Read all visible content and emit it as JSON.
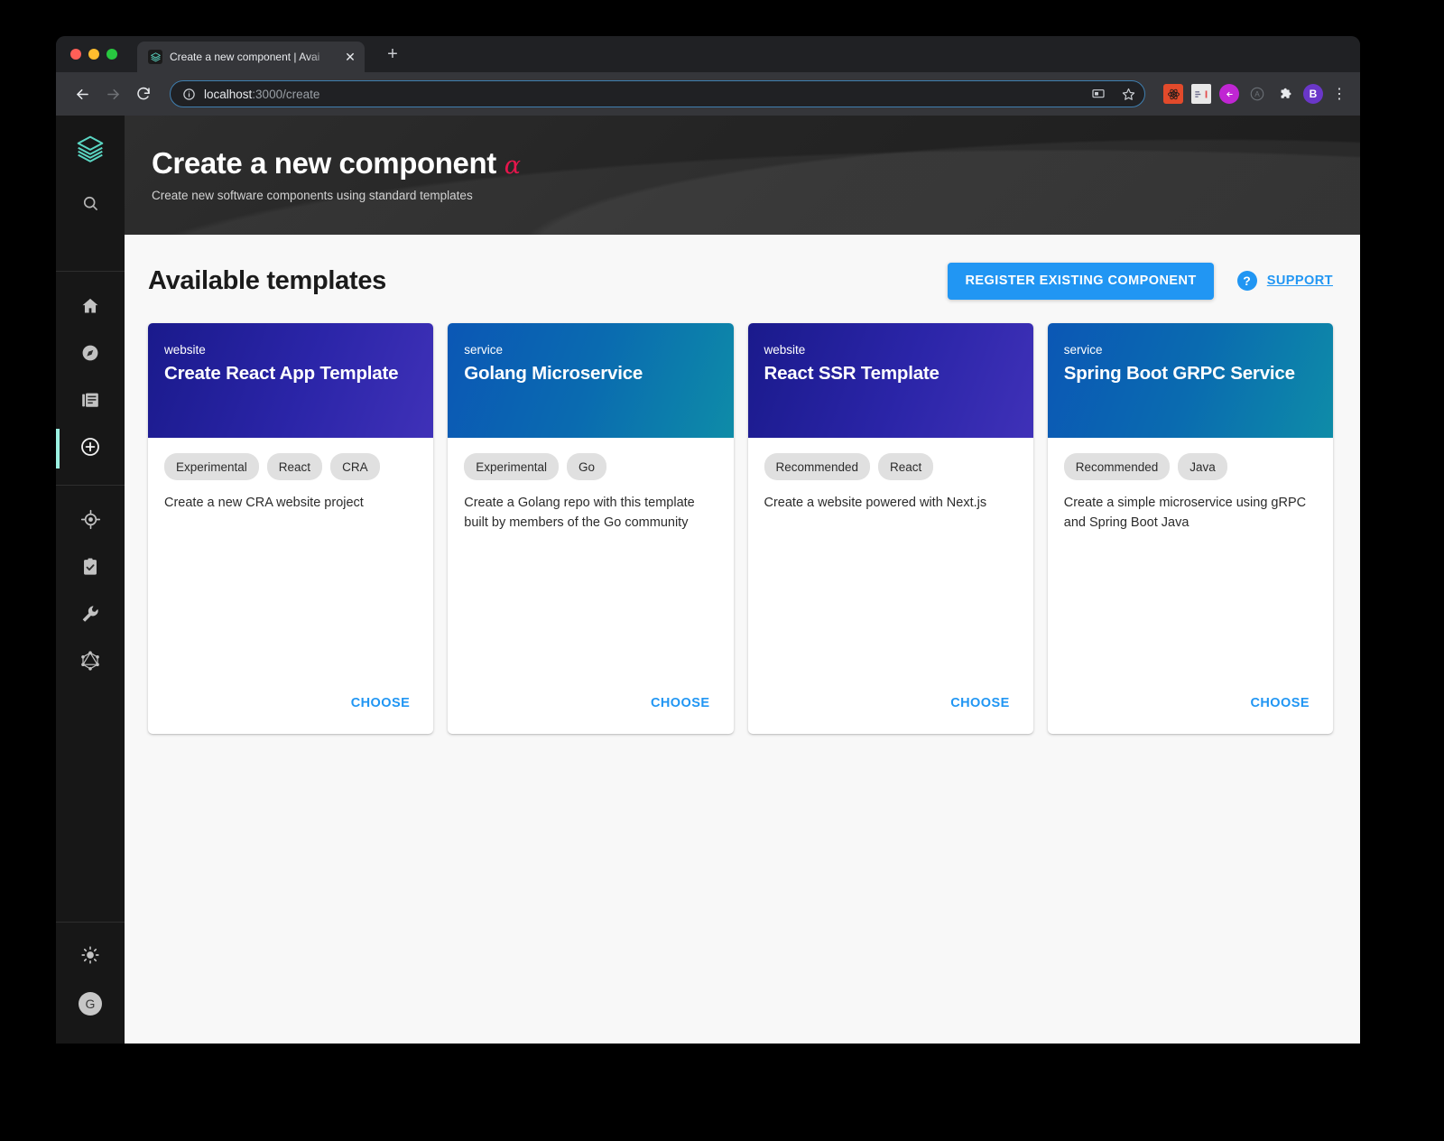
{
  "browser": {
    "tab": {
      "title": "Create a new component | Avai",
      "favicon_icon": "backstage-logo-icon",
      "close_icon": "close-icon"
    },
    "new_tab_icon": "plus-icon",
    "nav": {
      "back_icon": "arrow-left-icon",
      "forward_icon": "arrow-right-icon",
      "reload_icon": "reload-icon"
    },
    "omnibox": {
      "info_icon": "info-circle-icon",
      "url_host": "localhost",
      "url_path": ":3000/create",
      "url_full": "localhost:3000/create",
      "cast_icon": "cast-icon",
      "bookmark_icon": "star-icon"
    },
    "extensions": [
      {
        "name": "react-devtools-icon",
        "label": ""
      },
      {
        "name": "json-viewer-icon",
        "label": ""
      },
      {
        "name": "pocket-icon",
        "label": ""
      },
      {
        "name": "accessibility-icon",
        "label": "A"
      },
      {
        "name": "extensions-puzzle-icon",
        "label": ""
      },
      {
        "name": "profile-avatar",
        "label": "B"
      }
    ],
    "menu_icon": "kebab-menu-icon"
  },
  "sidebar": {
    "logo": {
      "name": "backstage-logo-icon"
    },
    "items": [
      {
        "name": "sidebar-item-search",
        "icon": "search-icon",
        "active": false
      },
      {
        "name": "sidebar-item-home",
        "icon": "home-icon",
        "active": false
      },
      {
        "name": "sidebar-item-explore",
        "icon": "compass-icon",
        "active": false
      },
      {
        "name": "sidebar-item-docs",
        "icon": "library-books-icon",
        "active": false
      },
      {
        "name": "sidebar-item-create",
        "icon": "plus-circle-icon",
        "active": true
      },
      {
        "name": "sidebar-item-tech-radar",
        "icon": "target-icon",
        "active": false
      },
      {
        "name": "sidebar-item-lighthouse",
        "icon": "clipboard-check-icon",
        "active": false
      },
      {
        "name": "sidebar-item-tools",
        "icon": "wrench-icon",
        "active": false
      },
      {
        "name": "sidebar-item-graphiql",
        "icon": "graphql-icon",
        "active": false
      }
    ],
    "footer": [
      {
        "name": "sidebar-item-theme-toggle",
        "icon": "brightness-icon"
      },
      {
        "name": "sidebar-item-user",
        "icon": "user-avatar",
        "label": "G"
      }
    ]
  },
  "header": {
    "title": "Create a new component",
    "alpha_badge": "α",
    "subtitle": "Create new software components using standard templates"
  },
  "section": {
    "title": "Available templates",
    "register_label": "REGISTER EXISTING COMPONENT",
    "support_label": "SUPPORT",
    "support_icon": "help-circle-icon"
  },
  "colors": {
    "accent_blue": "#2196f3",
    "alpha_pink": "#e6164c",
    "sidebar_bg": "#171717",
    "active_indicator": "#9bf0e1",
    "page_bg": "#f8f8f8",
    "tag_bg": "#e0e0e0"
  },
  "templates": [
    {
      "kind": "website",
      "name": "Create React App Template",
      "tags": [
        "Experimental",
        "React",
        "CRA"
      ],
      "description": "Create a new CRA website project",
      "choose_label": "CHOOSE",
      "gradient_from": "#1a1a8c",
      "gradient_to": "#3f31b8"
    },
    {
      "kind": "service",
      "name": "Golang Microservice",
      "tags": [
        "Experimental",
        "Go"
      ],
      "description": "Create a Golang repo with this template built by members of the Go community",
      "choose_label": "CHOOSE",
      "gradient_from": "#0b57b5",
      "gradient_to": "#0e8ca8"
    },
    {
      "kind": "website",
      "name": "React SSR Template",
      "tags": [
        "Recommended",
        "React"
      ],
      "description": "Create a website powered with Next.js",
      "choose_label": "CHOOSE",
      "gradient_from": "#1a1a8c",
      "gradient_to": "#3f31b8"
    },
    {
      "kind": "service",
      "name": "Spring Boot GRPC Service",
      "tags": [
        "Recommended",
        "Java"
      ],
      "description": "Create a simple microservice using gRPC and Spring Boot Java",
      "choose_label": "CHOOSE",
      "gradient_from": "#0b57b5",
      "gradient_to": "#0e8ca8"
    }
  ]
}
